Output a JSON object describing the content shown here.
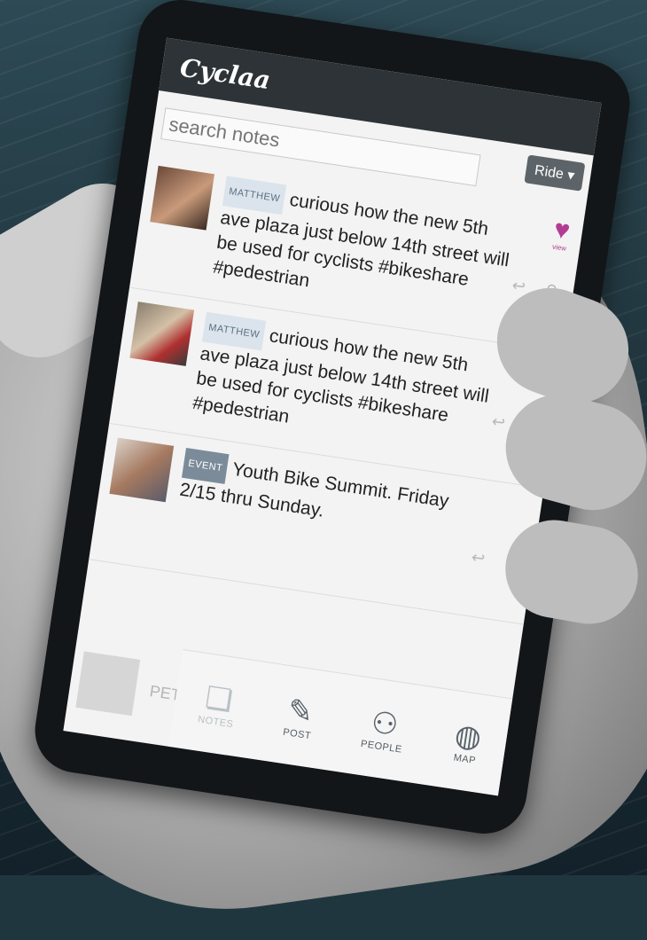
{
  "app": {
    "title": "Cyclaa"
  },
  "search": {
    "placeholder": "search notes"
  },
  "filter": {
    "label": "Ride"
  },
  "like": {
    "label": "view"
  },
  "posts": [
    {
      "tag": "MATTHEW",
      "text": "curious how the new 5th ave plaza just below 14th street will be used for cyclists #bikeshare #pedestrian"
    },
    {
      "tag": "MATTHEW",
      "text": "curious how the new 5th ave plaza just below 14th street will be used for cyclists #bikeshare #pedestrian"
    },
    {
      "tag": "EVENT",
      "text": "Youth Bike Summit. Friday 2/15 thru Sunday."
    }
  ],
  "peek": {
    "text": "PETER #sinkhole"
  },
  "nav": [
    {
      "label": "NOTES",
      "icon": "notes-icon"
    },
    {
      "label": "POST",
      "icon": "post-icon"
    },
    {
      "label": "PEOPLE",
      "icon": "people-icon"
    },
    {
      "label": "MAP",
      "icon": "globe-icon"
    }
  ],
  "colors": {
    "header": "#2d3336",
    "heart": "#b33c93",
    "screen": "#f3f3f3"
  }
}
